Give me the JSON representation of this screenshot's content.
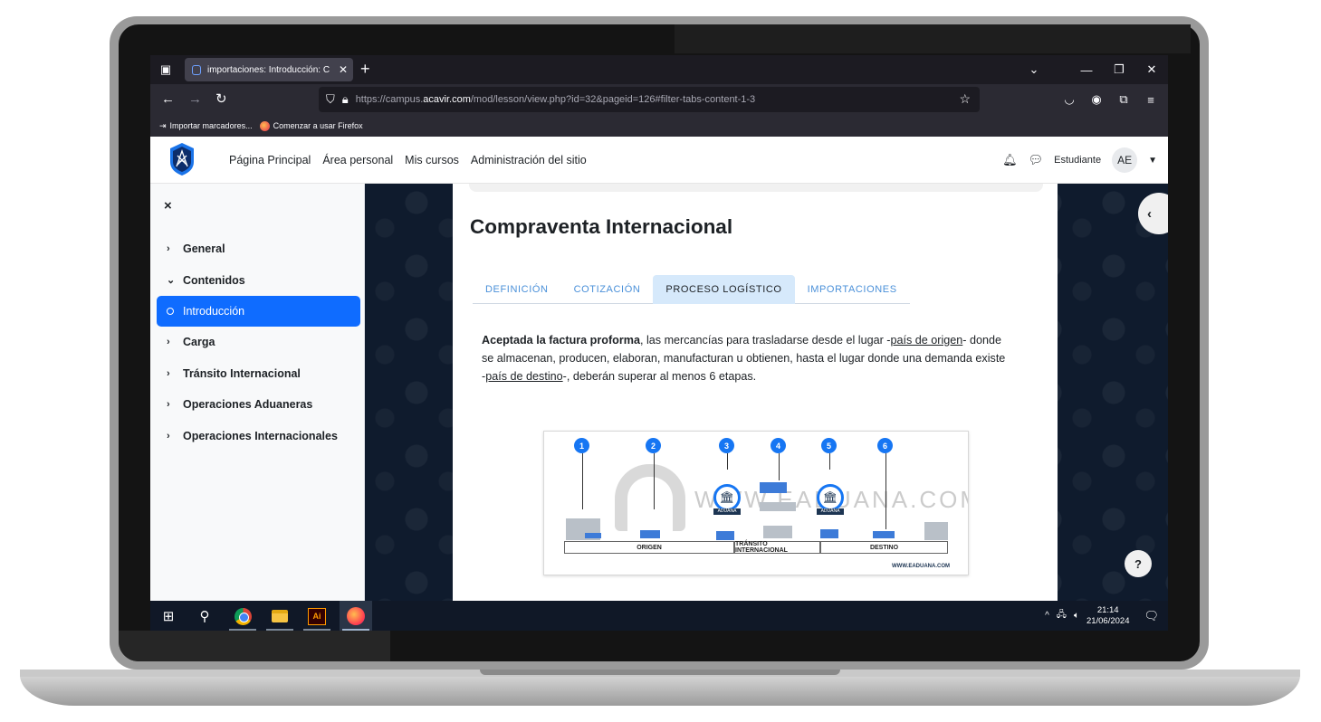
{
  "browser": {
    "tab_title": "importaciones: Introducción: C",
    "tab_close": "✕",
    "new_tab": "+",
    "window_controls": {
      "list": "⌄",
      "minimize": "—",
      "restore": "❐",
      "close": "✕"
    },
    "url_prefix": "https://campus.",
    "url_domain": "acavir.com",
    "url_path": "/mod/lesson/view.php?id=32&pageid=126#filter-tabs-content-1-3",
    "bookmarks": [
      {
        "label": "Importar marcadores..."
      },
      {
        "label": "Comenzar a usar Firefox"
      }
    ]
  },
  "header": {
    "nav": [
      "Página Principal",
      "Área personal",
      "Mis cursos",
      "Administración del sitio"
    ],
    "role": "Estudiante",
    "avatar_initials": "AE"
  },
  "drawer": {
    "close": "×",
    "items": [
      {
        "label": "General",
        "chevron": "›"
      },
      {
        "label": "Contenidos",
        "chevron": "⌄"
      },
      {
        "label": "Introducción",
        "active": true
      },
      {
        "label": "Carga",
        "chevron": "›"
      },
      {
        "label": "Tránsito Internacional",
        "chevron": "›"
      },
      {
        "label": "Operaciones Aduaneras",
        "chevron": "›"
      },
      {
        "label": "Operaciones Internacionales",
        "chevron": "›"
      }
    ]
  },
  "content": {
    "title": "Compraventa Internacional",
    "tabs": [
      "DEFINICIÓN",
      "COTIZACIÓN",
      "PROCESO LOGÍSTICO",
      "IMPORTACIONES"
    ],
    "active_tab": "PROCESO LOGÍSTICO",
    "paragraph": {
      "bold_lead": "Aceptada la factura proforma",
      "part1": ", las mercancías para trasladarse desde el lugar -",
      "link1": "país de origen",
      "part2": "- donde se almacenan, producen, elaboran, manufacturan u obtienen, hasta el lugar donde una demanda existe -",
      "link2": "país de destino",
      "part3": "-, deberán superar al menos 6 etapas."
    },
    "figure": {
      "markers": [
        "1",
        "2",
        "3",
        "4",
        "5",
        "6"
      ],
      "watermark": "WWW.EADUANA.COM",
      "aduana_label": "ADUANA",
      "segments": [
        "ORIGEN",
        "TRÁNSITO INTERNACIONAL",
        "DESTINO"
      ],
      "footer": "WWW.EADUANA.COM"
    },
    "help_label": "?",
    "drawer_toggle": "‹"
  },
  "taskbar": {
    "time": "21:14",
    "date": "21/06/2024",
    "ai_label": "Ai"
  },
  "colors": {
    "accent": "#0f6cff",
    "tab_active_bg": "#d6e9fb",
    "taskbar": "#101827",
    "browser_dark": "#1c1b22"
  }
}
